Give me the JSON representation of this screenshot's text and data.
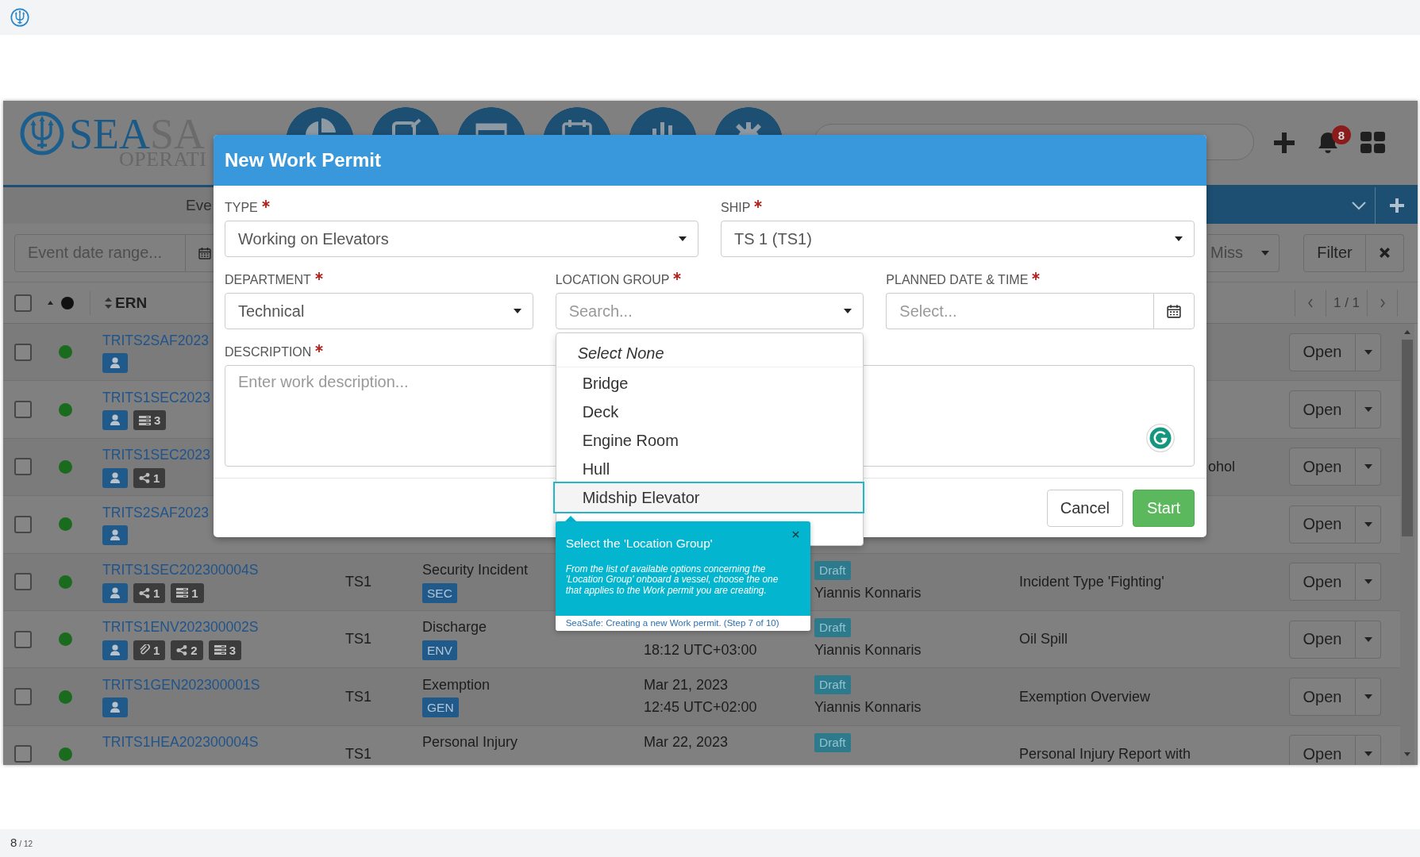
{
  "app": {
    "logo": {
      "primary": "SEA",
      "secondary": "SA",
      "tagline": "OPERATI"
    },
    "notifications": {
      "count": "8"
    },
    "tabs": [
      {
        "label": "Eve",
        "selected": true
      }
    ],
    "filters": {
      "date_range": {
        "placeholder": "Event date range..."
      },
      "category": {
        "value": "Miss"
      },
      "filter_button": "Filter"
    },
    "table": {
      "header": {
        "all_checked": false,
        "sort_label": "ERN"
      },
      "pagination": "1 / 1",
      "rows": [
        {
          "checked": false,
          "ern": "TRITS2SAF2023",
          "badges": [
            {
              "kind": "person"
            }
          ],
          "action": "Open"
        },
        {
          "checked": false,
          "ern": "TRITS1SEC2023",
          "badges": [
            {
              "kind": "person"
            },
            {
              "kind": "list",
              "count": "3"
            }
          ],
          "action": "Open"
        },
        {
          "checked": false,
          "ern": "TRITS1SEC2023",
          "badges": [
            {
              "kind": "person"
            },
            {
              "kind": "share",
              "count": "1"
            }
          ],
          "description": "ohol",
          "description_cut": true,
          "action": "Open"
        },
        {
          "checked": false,
          "ern": "TRITS2SAF2023",
          "badges": [
            {
              "kind": "person"
            }
          ],
          "action": "Open"
        },
        {
          "checked": false,
          "ern": "TRITS1SEC202300004S",
          "badges": [
            {
              "kind": "person"
            },
            {
              "kind": "share",
              "count": "1"
            },
            {
              "kind": "list",
              "count": "1"
            }
          ],
          "ship": "TS1",
          "type": "Security Incident",
          "type_code": "SEC",
          "status": "Draft",
          "owner": "Yiannis Konnaris",
          "description": "Incident Type 'Fighting'",
          "action": "Open"
        },
        {
          "checked": false,
          "ern": "TRITS1ENV202300002S",
          "badges": [
            {
              "kind": "person"
            },
            {
              "kind": "attachment",
              "count": "1"
            },
            {
              "kind": "share",
              "count": "2"
            },
            {
              "kind": "list",
              "count": "3"
            }
          ],
          "ship": "TS1",
          "type": "Discharge",
          "type_code": "ENV",
          "time": "18:12 UTC+03:00",
          "status": "Draft",
          "owner": "Yiannis Konnaris",
          "description": "Oil Spill",
          "action": "Open"
        },
        {
          "checked": false,
          "ern": "TRITS1GEN202300001S",
          "badges": [
            {
              "kind": "person"
            }
          ],
          "ship": "TS1",
          "type": "Exemption",
          "type_code": "GEN",
          "date": "Mar 21, 2023",
          "time": "12:45 UTC+02:00",
          "status": "Draft",
          "owner": "Yiannis Konnaris",
          "description": "Exemption Overview",
          "action": "Open"
        },
        {
          "checked": false,
          "ern": "TRITS1HEA202300004S",
          "ship": "TS1",
          "type": "Personal Injury",
          "date": "Mar 22, 2023",
          "status": "Draft",
          "description": "Personal Injury Report with",
          "action": "Open"
        }
      ]
    }
  },
  "modal": {
    "title": "New Work Permit",
    "field_rows": [
      [
        {
          "label": "TYPE",
          "required": true,
          "kind": "select",
          "value": "Working on Elevators"
        },
        {
          "label": "SHIP",
          "required": true,
          "kind": "select",
          "value": "TS 1 (TS1)"
        }
      ],
      [
        {
          "label": "DEPARTMENT",
          "required": true,
          "kind": "select",
          "value": "Technical"
        },
        {
          "label": "LOCATION GROUP",
          "required": true,
          "kind": "select",
          "placeholder": "Search...",
          "options": [
            {
              "kind": "none",
              "label": "Select None",
              "selected": false
            },
            {
              "kind": "option",
              "label": "Bridge",
              "selected": false
            },
            {
              "kind": "option",
              "label": "Deck",
              "selected": false
            },
            {
              "kind": "option",
              "label": "Engine Room",
              "selected": false
            },
            {
              "kind": "option",
              "label": "Hull",
              "selected": false
            },
            {
              "kind": "option",
              "label": "Midship Elevator",
              "selected": true
            }
          ],
          "tour_tip": {
            "title": "Select the 'Location Group'",
            "body": "From the list of available options concerning the 'Location Group' onboard a vessel, choose the one that applies to the Work permit you are creating.",
            "footer": "SeaSafe: Creating a new Work permit. (Step 7 of 10)"
          }
        },
        {
          "label": "PLANNED DATE & TIME",
          "required": true,
          "kind": "date",
          "placeholder": "Select..."
        }
      ],
      [
        {
          "label": "DESCRIPTION",
          "required": true,
          "kind": "textarea",
          "placeholder": "Enter work description..."
        }
      ]
    ],
    "buttons": [
      {
        "kind": "secondary",
        "label": "Cancel"
      },
      {
        "kind": "primary",
        "label": "Start"
      }
    ]
  },
  "page_counter": {
    "current": "8",
    "total": "/ 12"
  }
}
